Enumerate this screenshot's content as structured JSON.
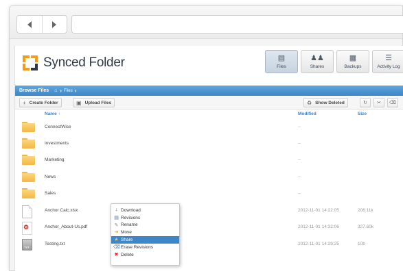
{
  "brand": {
    "name": "Synced Folder"
  },
  "nav": [
    {
      "label": "Files",
      "icon": "files-icon",
      "active": true
    },
    {
      "label": "Shares",
      "icon": "users-icon",
      "active": false
    },
    {
      "label": "Backups",
      "icon": "backup-icon",
      "active": false
    },
    {
      "label": "Activity Log",
      "icon": "list-icon",
      "active": false
    }
  ],
  "breadcrumb": {
    "title": "Browse Files",
    "path": "Files"
  },
  "actions": {
    "create_folder": "Create Folder",
    "upload_files": "Upload Files",
    "show_deleted": "Show Deleted"
  },
  "columns": {
    "name": "Name ↑",
    "modified": "Modified",
    "size": "Size"
  },
  "files": [
    {
      "name": "ConnectWise",
      "type": "folder",
      "modified": "--",
      "size": ""
    },
    {
      "name": "Investments",
      "type": "folder",
      "modified": "--",
      "size": ""
    },
    {
      "name": "Marketing",
      "type": "folder",
      "modified": "--",
      "size": ""
    },
    {
      "name": "News",
      "type": "folder",
      "modified": "--",
      "size": ""
    },
    {
      "name": "Sales",
      "type": "folder",
      "modified": "--",
      "size": ""
    },
    {
      "name": "Anchor Calc.xlsx",
      "type": "xlsx",
      "modified": "2012-11-01 14:22:05",
      "size": "206.11k"
    },
    {
      "name": "Anchor_About-Us.pdf",
      "type": "pdf",
      "modified": "2012-11-01 14:32:06",
      "size": "327.60k"
    },
    {
      "name": "Testing.txt",
      "type": "txt",
      "modified": "2012-11-01 14:29:25",
      "size": "10b"
    }
  ],
  "context_menu": {
    "items": [
      {
        "label": "Download",
        "icon": "download-icon",
        "color": "#2f8a3a"
      },
      {
        "label": "Revisions",
        "icon": "revisions-icon",
        "color": "#4a6fa8"
      },
      {
        "label": "Rename",
        "icon": "rename-icon",
        "color": "#888888"
      },
      {
        "label": "Move",
        "icon": "move-icon",
        "color": "#d9a22b"
      },
      {
        "label": "Share",
        "icon": "share-icon",
        "color": "#e0b53a",
        "selected": true
      },
      {
        "label": "Erase Revisions",
        "icon": "erase-icon",
        "color": "#4a6fa8"
      },
      {
        "label": "Delete",
        "icon": "delete-icon",
        "color": "#d32f2f"
      }
    ]
  },
  "colors": {
    "accent": "#3c87c7",
    "header_text": "#3a7fc4",
    "selected": "#3f86c9"
  }
}
